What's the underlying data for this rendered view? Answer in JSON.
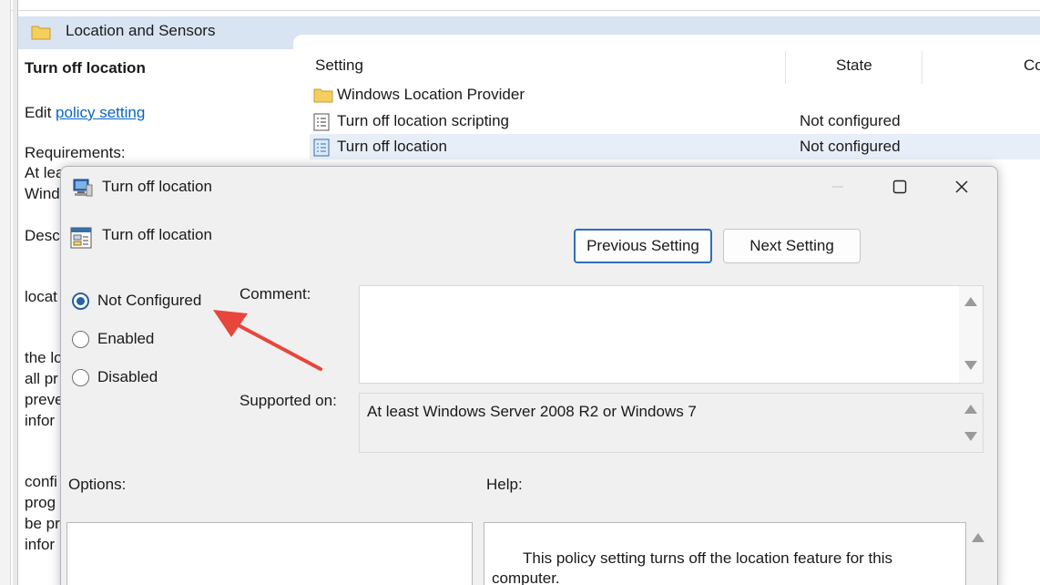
{
  "background_window": {
    "header_title": "Location and Sensors",
    "description": {
      "title": "Turn off location",
      "edit_prefix": "Edit",
      "edit_link": "policy setting",
      "fragments": [
        "Requirements:",
        "At lea",
        "Wind",
        "Descr",
        "locat",
        "the lo",
        "all pr",
        "preve",
        "infor",
        "confi",
        "prog",
        "be pr",
        "infor"
      ]
    },
    "columns": {
      "setting": "Setting",
      "state": "State",
      "comment": "Co"
    },
    "rows": [
      {
        "name": "Windows Location Provider",
        "state": "",
        "icon": "folder-icon"
      },
      {
        "name": "Turn off location scripting",
        "state": "Not configured",
        "icon": "policy-icon"
      },
      {
        "name": "Turn off location",
        "state": "Not configured",
        "icon": "policy-icon",
        "selected": true
      }
    ]
  },
  "dialog": {
    "title": "Turn off location",
    "policy_name": "Turn off location",
    "buttons": {
      "previous": "Previous Setting",
      "next": "Next Setting"
    },
    "radios": [
      {
        "label": "Not Configured",
        "checked": true
      },
      {
        "label": "Enabled",
        "checked": false
      },
      {
        "label": "Disabled",
        "checked": false
      }
    ],
    "comment_label": "Comment:",
    "comment_value": "",
    "supported_label": "Supported on:",
    "supported_value": "At least Windows Server 2008 R2 or Windows 7",
    "options_label": "Options:",
    "help_label": "Help:",
    "help_text": "This policy setting turns off the location feature for this computer."
  },
  "annotation": {
    "arrow_color": "#e8453c",
    "points_to": "Not Configured"
  }
}
